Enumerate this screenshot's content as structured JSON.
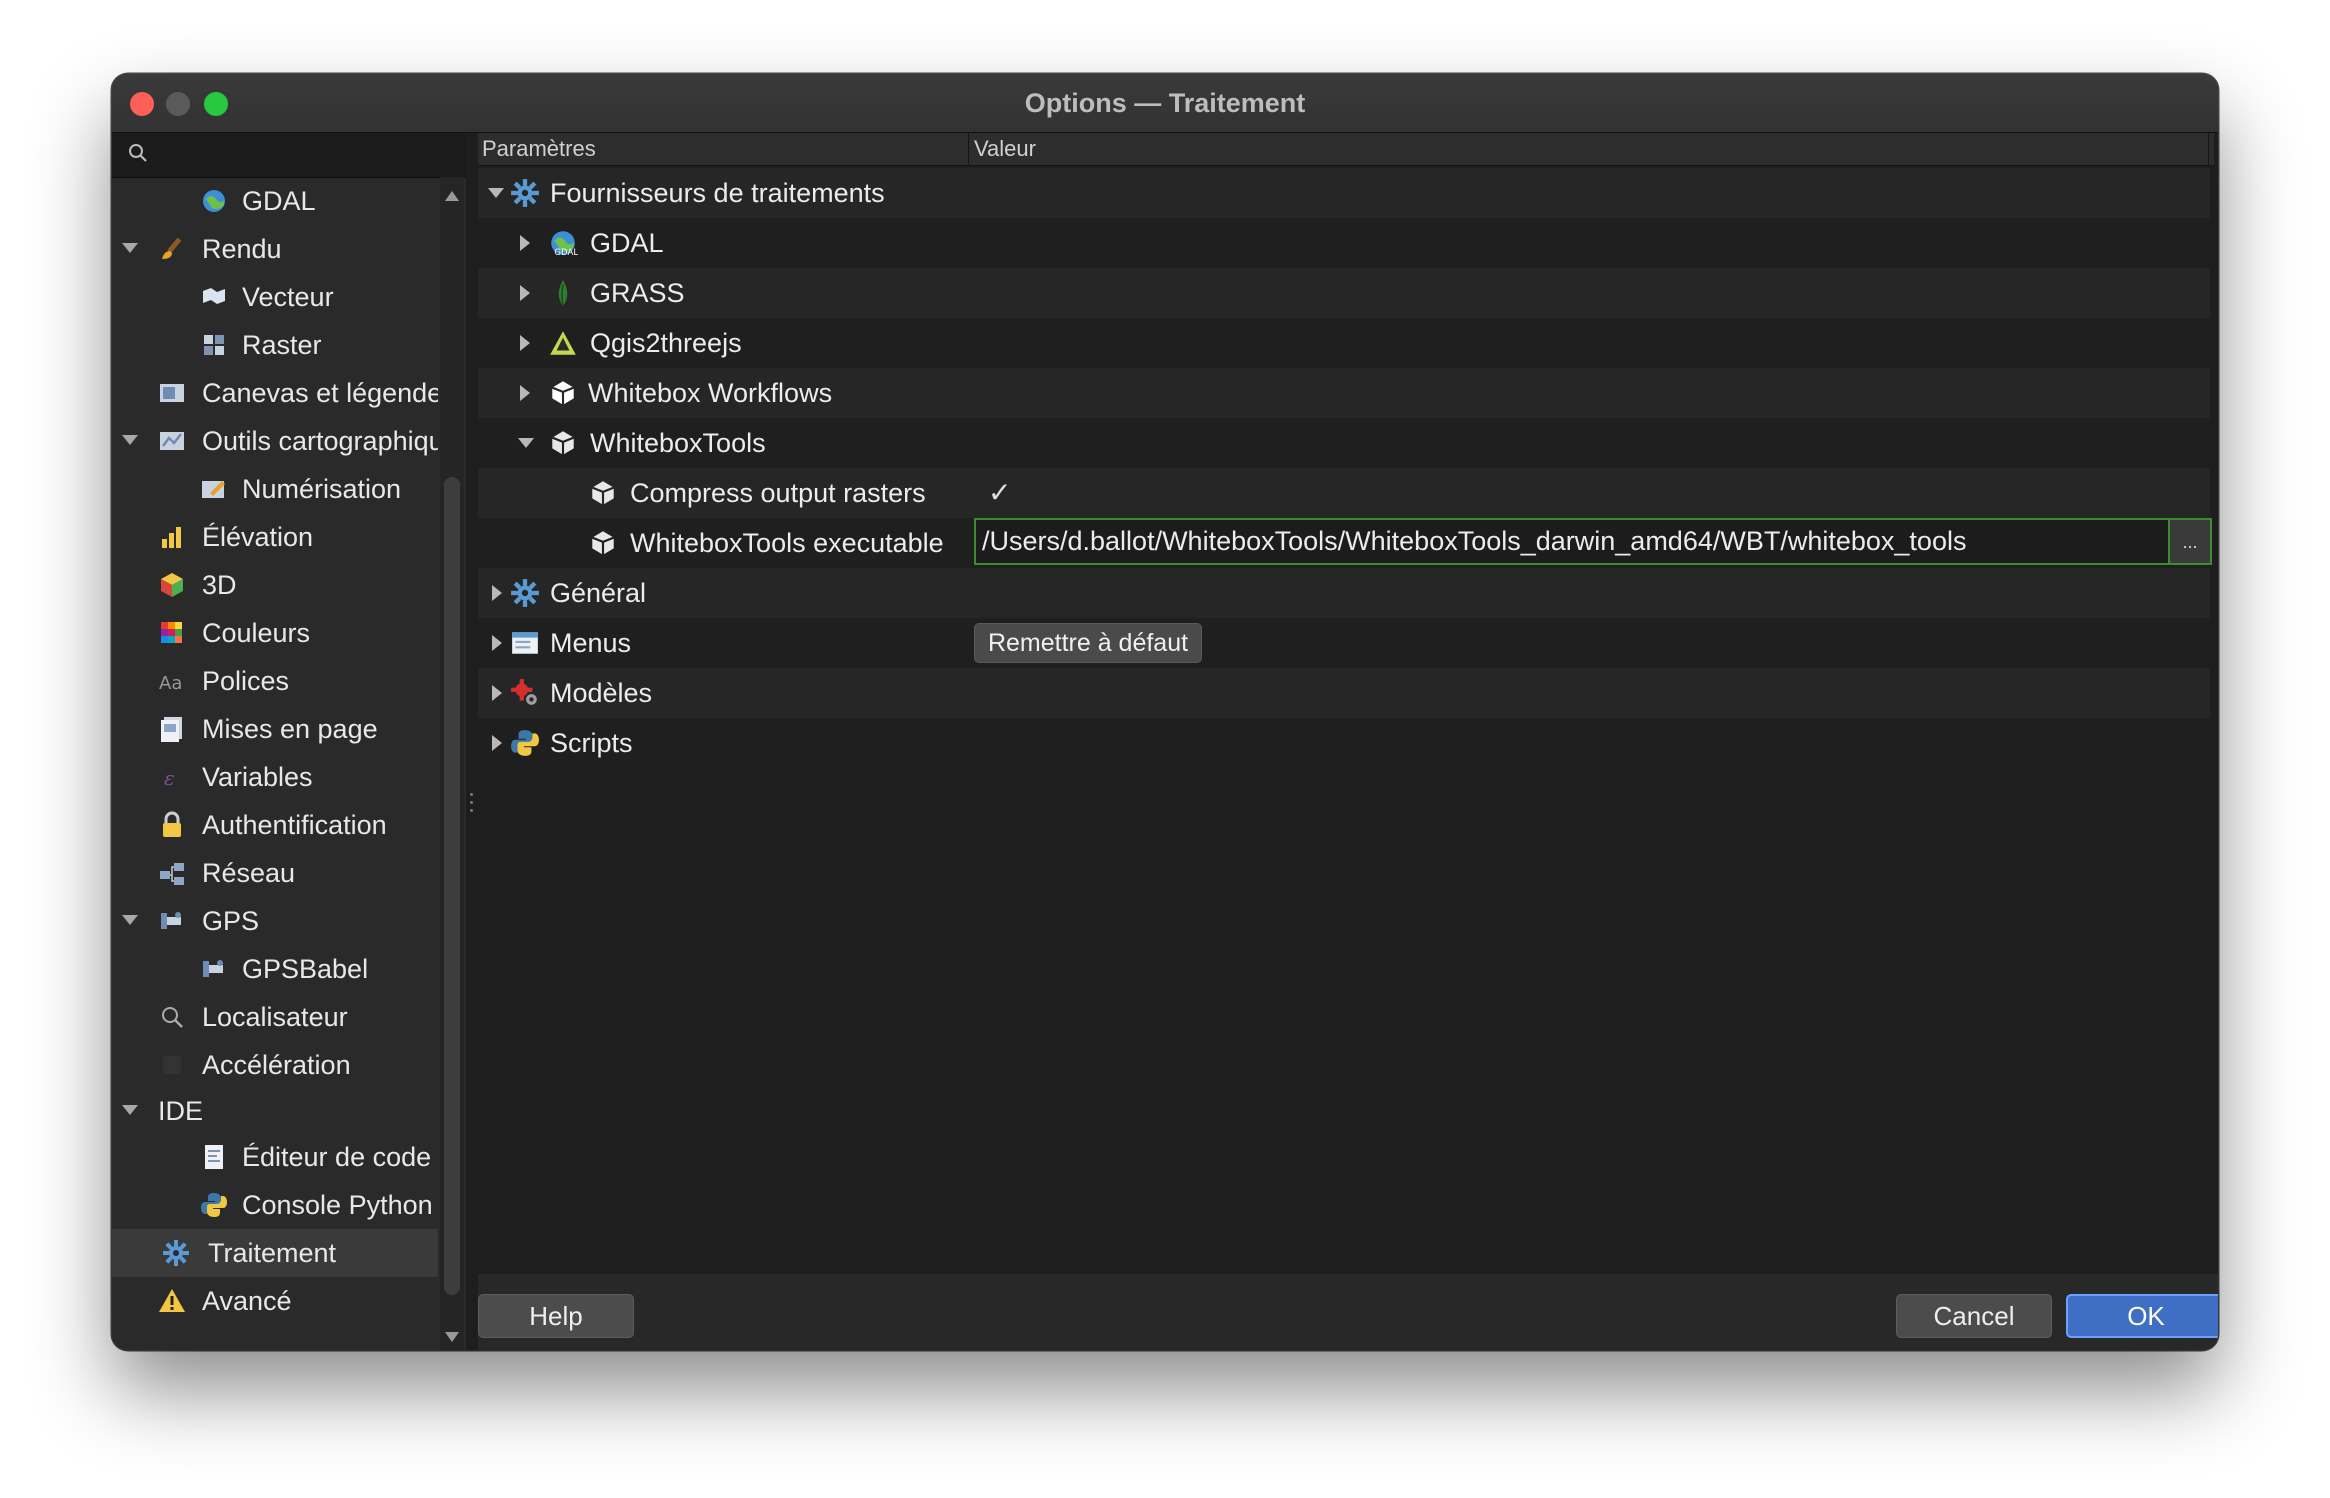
{
  "window": {
    "title": "Options — Traitement"
  },
  "search": {
    "placeholder": ""
  },
  "sidebar": {
    "items": [
      {
        "label": "GDAL",
        "icon": "globe-icon"
      },
      {
        "label": "Rendu",
        "icon": "brush-icon"
      },
      {
        "label": "Vecteur",
        "icon": "vector-icon"
      },
      {
        "label": "Raster",
        "icon": "raster-icon"
      },
      {
        "label": "Canevas et légende",
        "icon": "canvas-icon"
      },
      {
        "label": "Outils cartographiques",
        "icon": "map-tools-icon"
      },
      {
        "label": "Numérisation",
        "icon": "digitizing-icon"
      },
      {
        "label": "Élévation",
        "icon": "elevation-icon"
      },
      {
        "label": "3D",
        "icon": "cube-3d-icon"
      },
      {
        "label": "Couleurs",
        "icon": "colors-icon"
      },
      {
        "label": "Polices",
        "icon": "fonts-icon"
      },
      {
        "label": "Mises en page",
        "icon": "layouts-icon"
      },
      {
        "label": "Variables",
        "icon": "variables-icon"
      },
      {
        "label": "Authentification",
        "icon": "lock-icon"
      },
      {
        "label": "Réseau",
        "icon": "network-icon"
      },
      {
        "label": "GPS",
        "icon": "gps-icon"
      },
      {
        "label": "GPSBabel",
        "icon": "gpsbabel-icon"
      },
      {
        "label": "Localisateur",
        "icon": "search-icon"
      },
      {
        "label": "Accélération",
        "icon": "acceleration-icon"
      },
      {
        "label": "IDE",
        "icon": ""
      },
      {
        "label": "Éditeur de code",
        "icon": "code-editor-icon"
      },
      {
        "label": "Console Python",
        "icon": "python-icon"
      },
      {
        "label": "Traitement",
        "icon": "gear-icon"
      },
      {
        "label": "Avancé",
        "icon": "warning-icon"
      }
    ]
  },
  "tree": {
    "headers": {
      "params": "Paramètres",
      "value": "Valeur"
    },
    "rows": [
      {
        "label": "Fournisseurs de traitements",
        "icon": "gear-icon"
      },
      {
        "label": "GDAL",
        "icon": "gdal-icon"
      },
      {
        "label": "GRASS",
        "icon": "grass-icon"
      },
      {
        "label": "Qgis2threejs",
        "icon": "qgis2threejs-icon"
      },
      {
        "label": "Whitebox Workflows",
        "icon": "whitebox-icon"
      },
      {
        "label": "WhiteboxTools",
        "icon": "whitebox-icon"
      },
      {
        "label": "Compress output rasters",
        "icon": "whitebox-icon",
        "value": "✓"
      },
      {
        "label": "WhiteboxTools executable",
        "icon": "whitebox-icon",
        "value": "/Users/d.ballot/WhiteboxTools/WhiteboxTools_darwin_amd64/WBT/whitebox_tools",
        "browse": "..."
      },
      {
        "label": "Général",
        "icon": "gear-icon"
      },
      {
        "label": "Menus",
        "icon": "menus-icon",
        "value": "Remettre à défaut"
      },
      {
        "label": "Modèles",
        "icon": "models-icon"
      },
      {
        "label": "Scripts",
        "icon": "python-icon"
      }
    ]
  },
  "footer": {
    "help": "Help",
    "cancel": "Cancel",
    "ok": "OK"
  }
}
